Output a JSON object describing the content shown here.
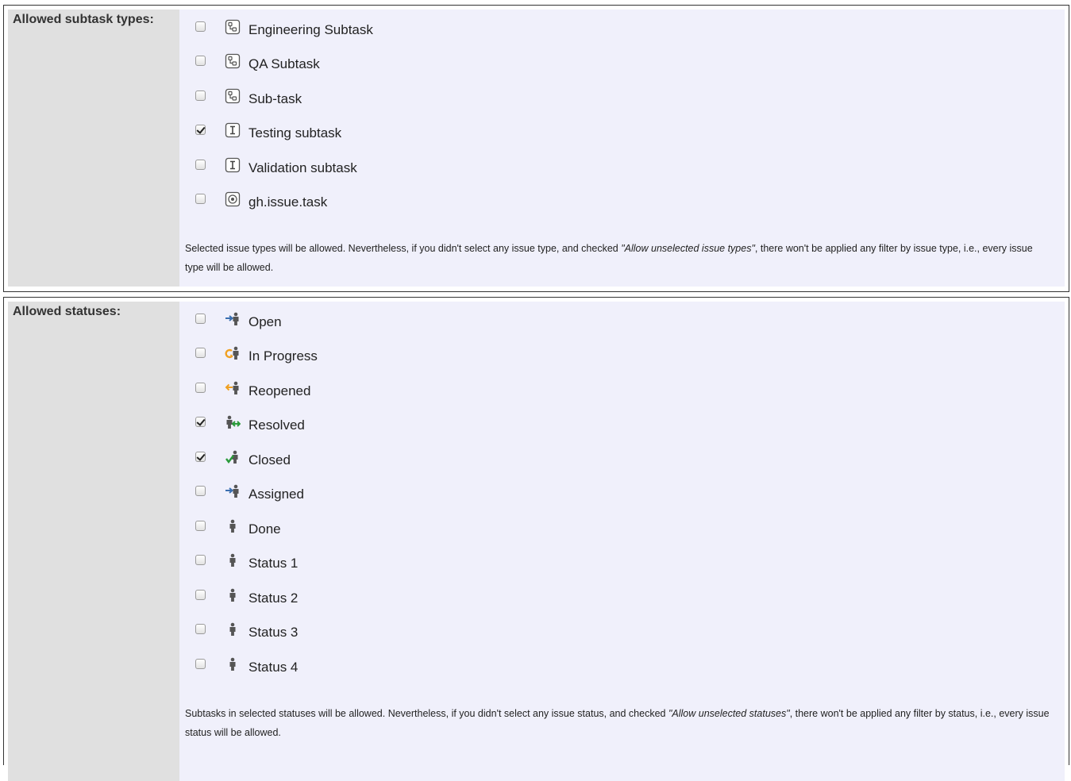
{
  "subtask_types": {
    "label": "Allowed subtask types:",
    "options": [
      {
        "label": "Engineering Subtask",
        "checked": false,
        "icon": "subtask-icon"
      },
      {
        "label": "QA Subtask",
        "checked": false,
        "icon": "subtask-icon"
      },
      {
        "label": "Sub-task",
        "checked": false,
        "icon": "subtask-icon"
      },
      {
        "label": "Testing subtask",
        "checked": true,
        "icon": "info-box-icon"
      },
      {
        "label": "Validation subtask",
        "checked": false,
        "icon": "info-box-icon"
      },
      {
        "label": "gh.issue.task",
        "checked": false,
        "icon": "target-icon"
      }
    ],
    "desc_pre": "Selected issue types will be allowed. Nevertheless, if you didn't select any issue type, and checked ",
    "desc_em": "\"Allow unselected issue types\"",
    "desc_post": ", there won't be applied any filter by issue type, i.e., every issue type will be allowed."
  },
  "statuses": {
    "label": "Allowed statuses:",
    "options": [
      {
        "label": "Open",
        "checked": false,
        "icon": "status-open-icon"
      },
      {
        "label": "In Progress",
        "checked": false,
        "icon": "status-inprogress-icon"
      },
      {
        "label": "Reopened",
        "checked": false,
        "icon": "status-reopened-icon"
      },
      {
        "label": "Resolved",
        "checked": true,
        "icon": "status-resolved-icon"
      },
      {
        "label": "Closed",
        "checked": true,
        "icon": "status-closed-icon"
      },
      {
        "label": "Assigned",
        "checked": false,
        "icon": "status-assigned-icon"
      },
      {
        "label": "Done",
        "checked": false,
        "icon": "status-generic-icon"
      },
      {
        "label": "Status 1",
        "checked": false,
        "icon": "status-generic-icon"
      },
      {
        "label": "Status 2",
        "checked": false,
        "icon": "status-generic-icon"
      },
      {
        "label": "Status 3",
        "checked": false,
        "icon": "status-generic-icon"
      },
      {
        "label": "Status 4",
        "checked": false,
        "icon": "status-generic-icon"
      }
    ],
    "desc_pre": "Subtasks in selected statuses will be allowed. Nevertheless, if you didn't select any issue status, and checked ",
    "desc_em": "\"Allow unselected statuses\"",
    "desc_post": ", there won't be applied any filter by status, i.e., every issue status will be allowed."
  },
  "colors": {
    "label_bg": "#e0e0e0",
    "value_bg": "#f0f0fb",
    "arrow_blue": "#3a6fb0",
    "arrow_orange": "#f0a020",
    "arrow_green": "#2a9a3a",
    "figure_gray": "#555555"
  }
}
